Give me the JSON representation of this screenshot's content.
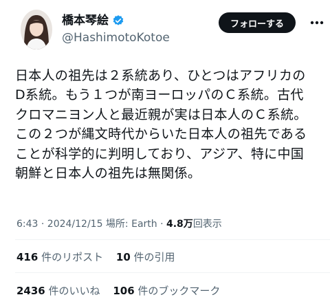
{
  "author": {
    "display_name": "橋本琴絵",
    "handle": "@HashimotoKotoe",
    "verified": true
  },
  "follow_label": "フォローする",
  "tweet_lines": [
    "日本人の祖先は２系統あり、ひとつはアフリカの",
    "D系統。もう１つが南ヨーロッパのＣ系統。古代",
    "クロマニヨン人と最近親が実は日本人のＣ系統。",
    "この２つが縄文時代からいた日本人の祖先である",
    "ことが科学的に判明しており、アジア、特に中国",
    "朝鮮と日本人の祖先は無関係。"
  ],
  "meta": {
    "time_date_location": "6:43 · 2024/12/15 場所: Earth · ",
    "views_count": "4.8万",
    "views_label": "回表示"
  },
  "stats": {
    "reposts_count": "416",
    "reposts_label": "件のリポスト",
    "quotes_count": "10",
    "quotes_label": "件の引用",
    "likes_count": "2436",
    "likes_label": "件のいいね",
    "bookmarks_count": "106",
    "bookmarks_label": "件のブックマーク"
  },
  "colors": {
    "verified_blue": "#1d9bf0",
    "text_primary": "#0f1419",
    "text_secondary": "#536471"
  },
  "icons": [
    "verified-badge-icon",
    "more-options-icon"
  ]
}
